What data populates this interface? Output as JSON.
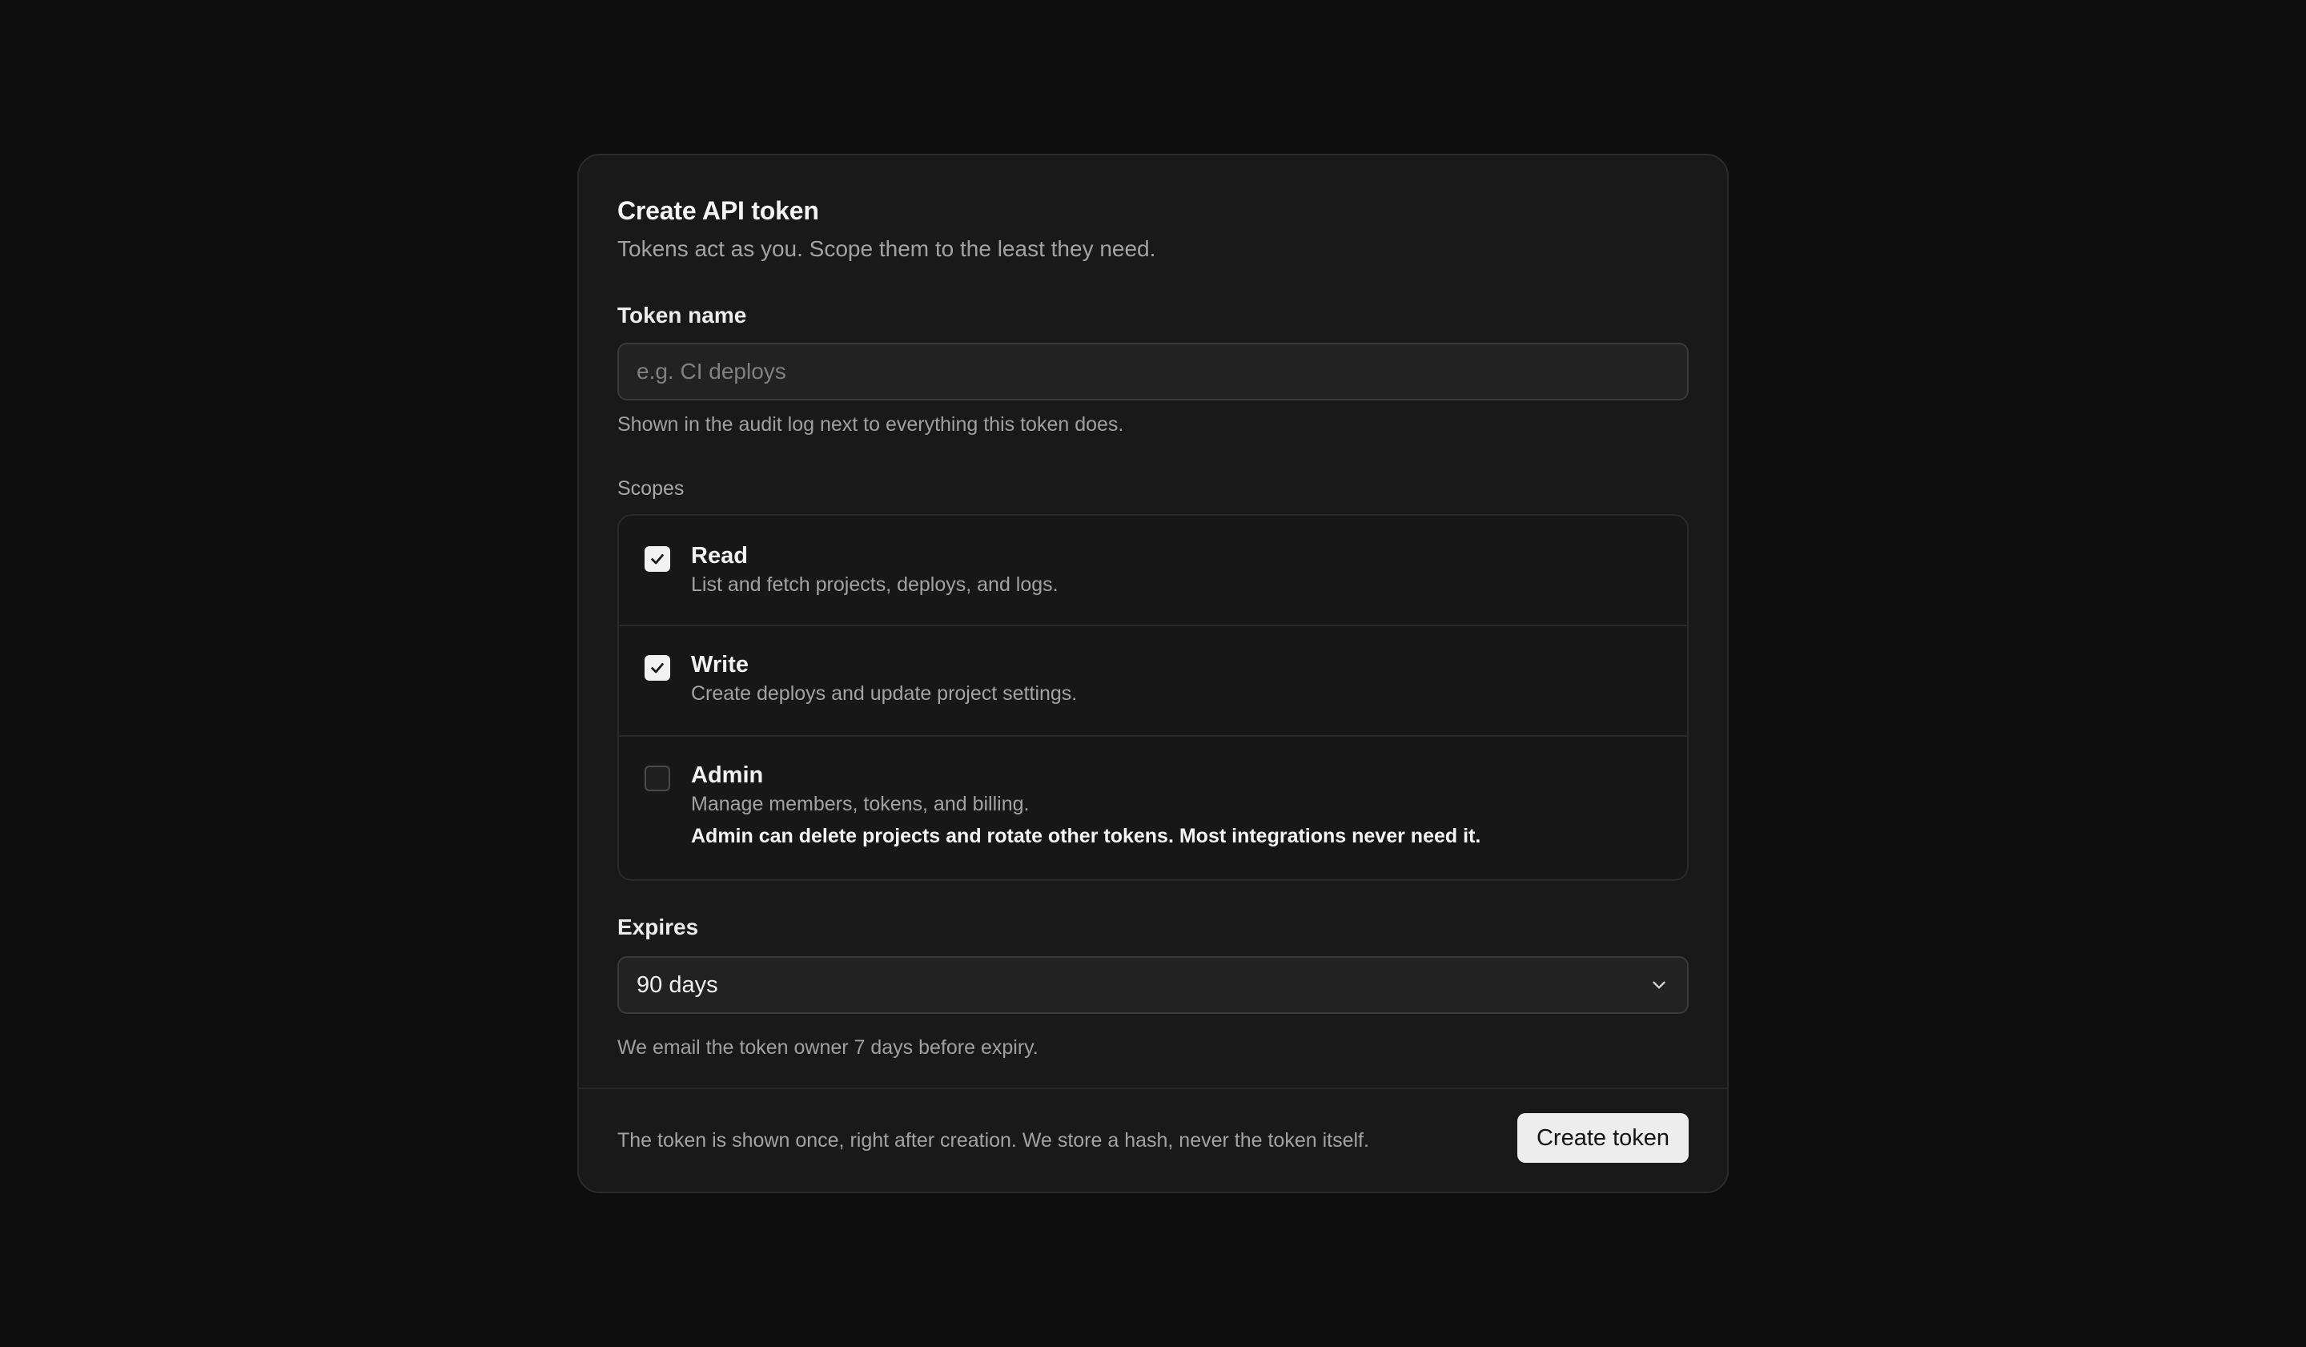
{
  "dialog": {
    "title": "Create API token",
    "subtitle": "Tokens act as you. Scope them to the least they need."
  },
  "token_name": {
    "label": "Token name",
    "value": "",
    "placeholder": "e.g. CI deploys",
    "hint": "Shown in the audit log next to everything this token does."
  },
  "scopes": {
    "label": "Scopes",
    "items": [
      {
        "name": "Read",
        "description": "List and fetch projects, deploys, and logs.",
        "checked": true
      },
      {
        "name": "Write",
        "description": "Create deploys and update project settings.",
        "checked": true
      },
      {
        "name": "Admin",
        "description": "Manage members, tokens, and billing.",
        "warning": "Admin can delete projects and rotate other tokens. Most integrations never need it.",
        "checked": false
      }
    ]
  },
  "expires": {
    "label": "Expires",
    "selected": "90 days",
    "hint": "We email the token owner 7 days before expiry."
  },
  "footer": {
    "note": "The token is shown once, right after creation. We store a hash, never the token itself.",
    "create_label": "Create token"
  },
  "icons": {
    "checkbox_checked": "check-icon",
    "select_chevron": "chevron-down-icon"
  },
  "colors": {
    "background": "#0e0e0e",
    "card": "#191919",
    "primary_button": "#ededed"
  }
}
